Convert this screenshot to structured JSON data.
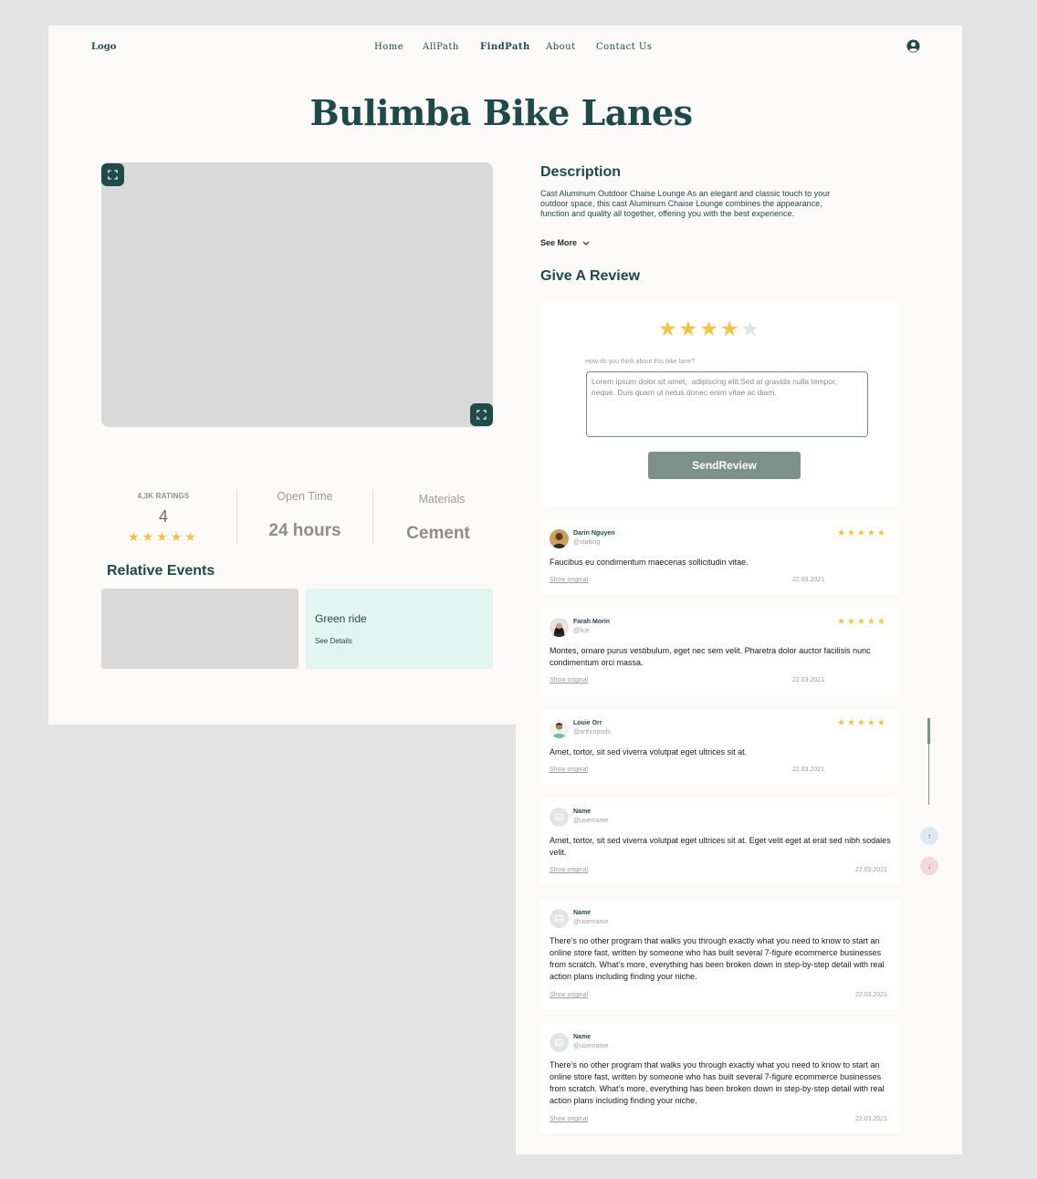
{
  "nav": {
    "logo": "Logo",
    "links": [
      "Home",
      "AllPath",
      "FindPath",
      "About",
      "Contact Us"
    ]
  },
  "page": {
    "title": "Bulimba Bike Lanes"
  },
  "stats": {
    "ratings_label": "4,3K RATINGS",
    "rating_value": "4",
    "open_label": "Open Time",
    "open_value": "24 hours",
    "materials_label": "Materials",
    "materials_value": "Cement"
  },
  "events": {
    "heading": "Relative Events",
    "name": "Green ride",
    "link": "See Details"
  },
  "description": {
    "heading": "Description",
    "text": "Cast Aluminum Outdoor Chaise Lounge As an elegant and classic touch to your outdoor space, this cast Aluminum Chaise Lounge combines the appearance, function and quality all together, offering you with the best experience.",
    "see_more": "See More"
  },
  "review_form": {
    "heading": "Give  A Review",
    "rating": 4,
    "prompt": "How do you think about this bike lane?",
    "input_value": "Lorem ipsum dolor sit amet,  adipiscing elit.Sed at gravida nulla tempor, neque. Duis quam ut netus donec enim vitae ac diam.",
    "send_label": "SendReview"
  },
  "reviews": [
    {
      "name": "Darin Nguyen",
      "username": "@staking",
      "text": "Faucibus eu condimentum maecenas sollicitudin vitae.",
      "show_original": "Show original",
      "date": "22.03.2021",
      "stars": 5
    },
    {
      "name": "Farah Morin",
      "username": "@lice",
      "text": "Montes, ornare purus vestibulum, eget nec sem velit. Pharetra dolor auctor facilisis nunc condimentum orci massa.",
      "show_original": "Show original",
      "date": "22.03.2021",
      "stars": 5
    },
    {
      "name": "Louie Orr",
      "username": "@arthropods",
      "text": "Amet, tortor, sit sed viverra volutpat eget ultrices sit at.",
      "show_original": "Show original",
      "date": "22.03.2021",
      "stars": 5
    },
    {
      "name": "Name",
      "username": "@username",
      "text": "Amet, tortor, sit sed viverra volutpat eget ultrices sit at. Eget velit eget at erat sed nibh sodales velit.",
      "show_original": "Show original",
      "date": "22.03.2021"
    },
    {
      "name": "Name",
      "username": "@username",
      "text": "There’s no other program that walks you through exactly what you need to know to start an online store fast, written by someone who has built several 7-figure ecommerce businesses from scratch. What’s more, everything has been broken down in step-by-step detail with real action plans including finding your niche.",
      "show_original": "Show original",
      "date": "22.03.2021"
    },
    {
      "name": "Name",
      "username": "@username",
      "text": "There’s no other program that walks you through exactly what you need to know to start an online store fast, written by someone who has built several 7-figure ecommerce businesses from scratch. What’s more, everything has been broken down in step-by-step detail with real action plans including finding your niche.",
      "show_original": "Show original",
      "date": "22.03.2021"
    }
  ],
  "scroll_controls": {
    "up": "↑",
    "down": "↓"
  },
  "colors": {
    "brand": "#1f4a4a",
    "star": "#f5c342",
    "button": "#7c9189",
    "event_card": "#e3f5f0",
    "scroll_up_bg": "#dde9f3",
    "scroll_down_bg": "#f3d9dc"
  }
}
